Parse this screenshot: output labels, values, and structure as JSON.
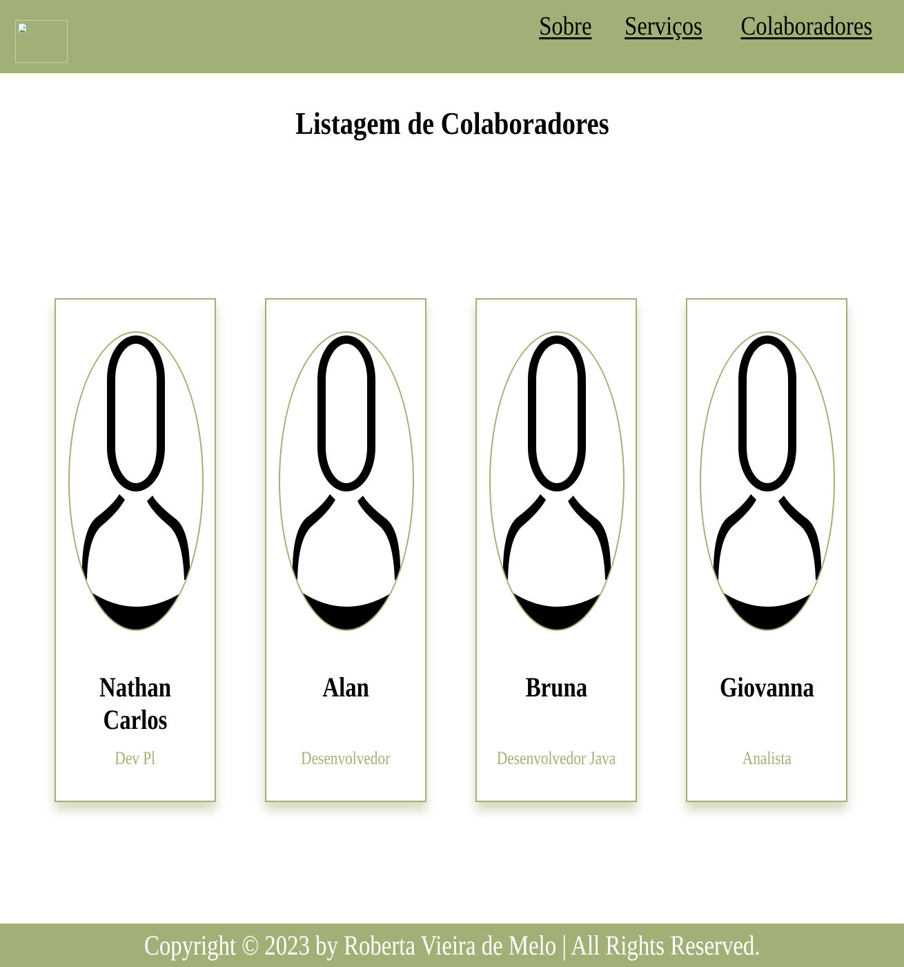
{
  "header": {
    "nav": [
      {
        "label": "Sobre"
      },
      {
        "label": "Serviços"
      },
      {
        "label": "Colaboradores"
      }
    ]
  },
  "main": {
    "title": "Listagem de Colaboradores",
    "cards": [
      {
        "name": "Nathan Carlos",
        "role": "Dev Pl"
      },
      {
        "name": "Alan",
        "role": "Desenvolvedor"
      },
      {
        "name": "Bruna",
        "role": "Desenvolvedor Java"
      },
      {
        "name": "Giovanna",
        "role": "Analista"
      }
    ]
  },
  "footer": {
    "text": "Copyright © 2023 by Roberta Vieira de Melo | All Rights Reserved."
  },
  "colors": {
    "accent": "#a1b077",
    "background": "#ffffff",
    "text": "#000000"
  },
  "icons": {
    "logo": "broken-image-icon",
    "avatar": "user-silhouette-icon"
  }
}
